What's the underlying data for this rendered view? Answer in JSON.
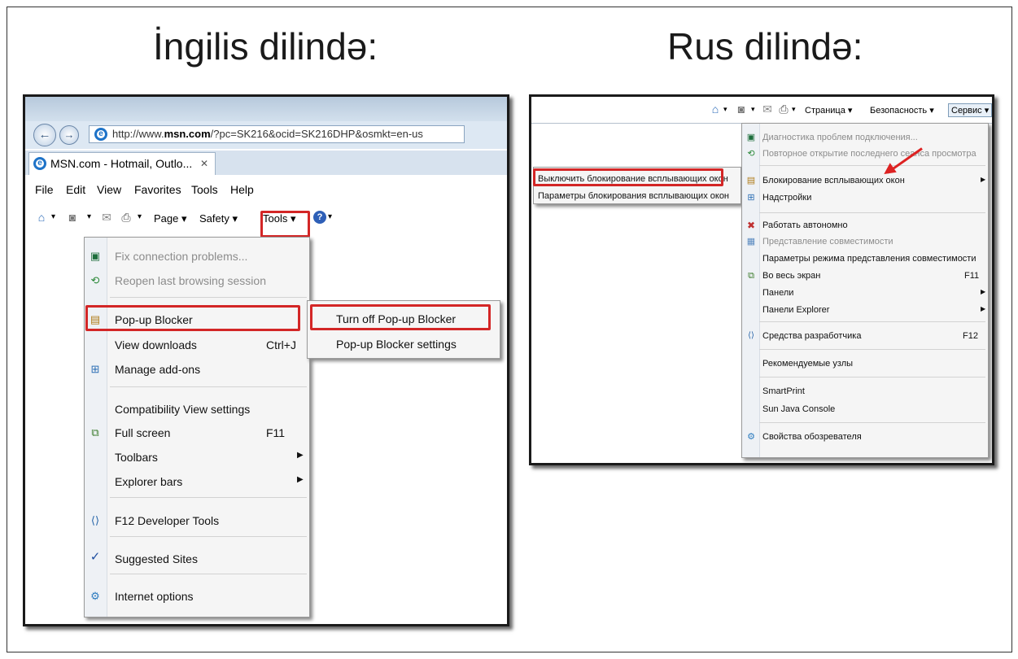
{
  "headings": {
    "english": "İngilis dilində:",
    "russian": "Rus dilində:"
  },
  "en": {
    "url_prefix": "http://www.",
    "url_domain": "msn.com",
    "url_rest": "/?pc=SK216&ocid=SK216DHP&osmkt=en-us",
    "tab_title": "MSN.com - Hotmail, Outlo...",
    "tab_close": "✕",
    "menubar": [
      "File",
      "Edit",
      "View",
      "Favorites",
      "Tools",
      "Help"
    ],
    "cmdbar": {
      "page": "Page ▾",
      "safety": "Safety ▾",
      "tools": "Tools ▾"
    },
    "tools_menu": {
      "fix": "Fix connection problems...",
      "reopen": "Reopen last browsing session",
      "popup": "Pop-up Blocker",
      "downloads": "View downloads",
      "downloads_key": "Ctrl+J",
      "addons": "Manage add-ons",
      "compat": "Compatibility View settings",
      "fullscreen": "Full screen",
      "fullscreen_key": "F11",
      "toolbars": "Toolbars",
      "explorer_bars": "Explorer bars",
      "devtools": "F12 Developer Tools",
      "suggested": "Suggested Sites",
      "options": "Internet options"
    },
    "submenu": {
      "turn_off": "Turn off Pop-up Blocker",
      "settings": "Pop-up Blocker settings"
    }
  },
  "ru": {
    "cmdbar": {
      "page": "Страница ▾",
      "safety": "Безопасность ▾",
      "tools": "Сервис ▾"
    },
    "submenu": {
      "turn_off": "Выключить блокирование всплывающих окон",
      "settings": "Параметры блокирования всплывающих окон"
    },
    "menu": {
      "diag": "Диагностика проблем подключения...",
      "reopen": "Повторное открытие последнего сеанса просмотра",
      "popup": "Блокирование всплывающих окон",
      "addons": "Надстройки",
      "offline": "Работать автономно",
      "compat": "Представление совместимости",
      "compat_settings": "Параметры режима представления совместимости",
      "fullscreen": "Во весь экран",
      "fullscreen_key": "F11",
      "panels": "Панели",
      "explorer_panels": "Панели Explorer",
      "devtools": "Средства разработчика",
      "devtools_key": "F12",
      "suggested": "Рекомендуемые узлы",
      "smartprint": "SmartPrint",
      "java": "Sun Java Console",
      "options": "Свойства обозревателя"
    }
  }
}
